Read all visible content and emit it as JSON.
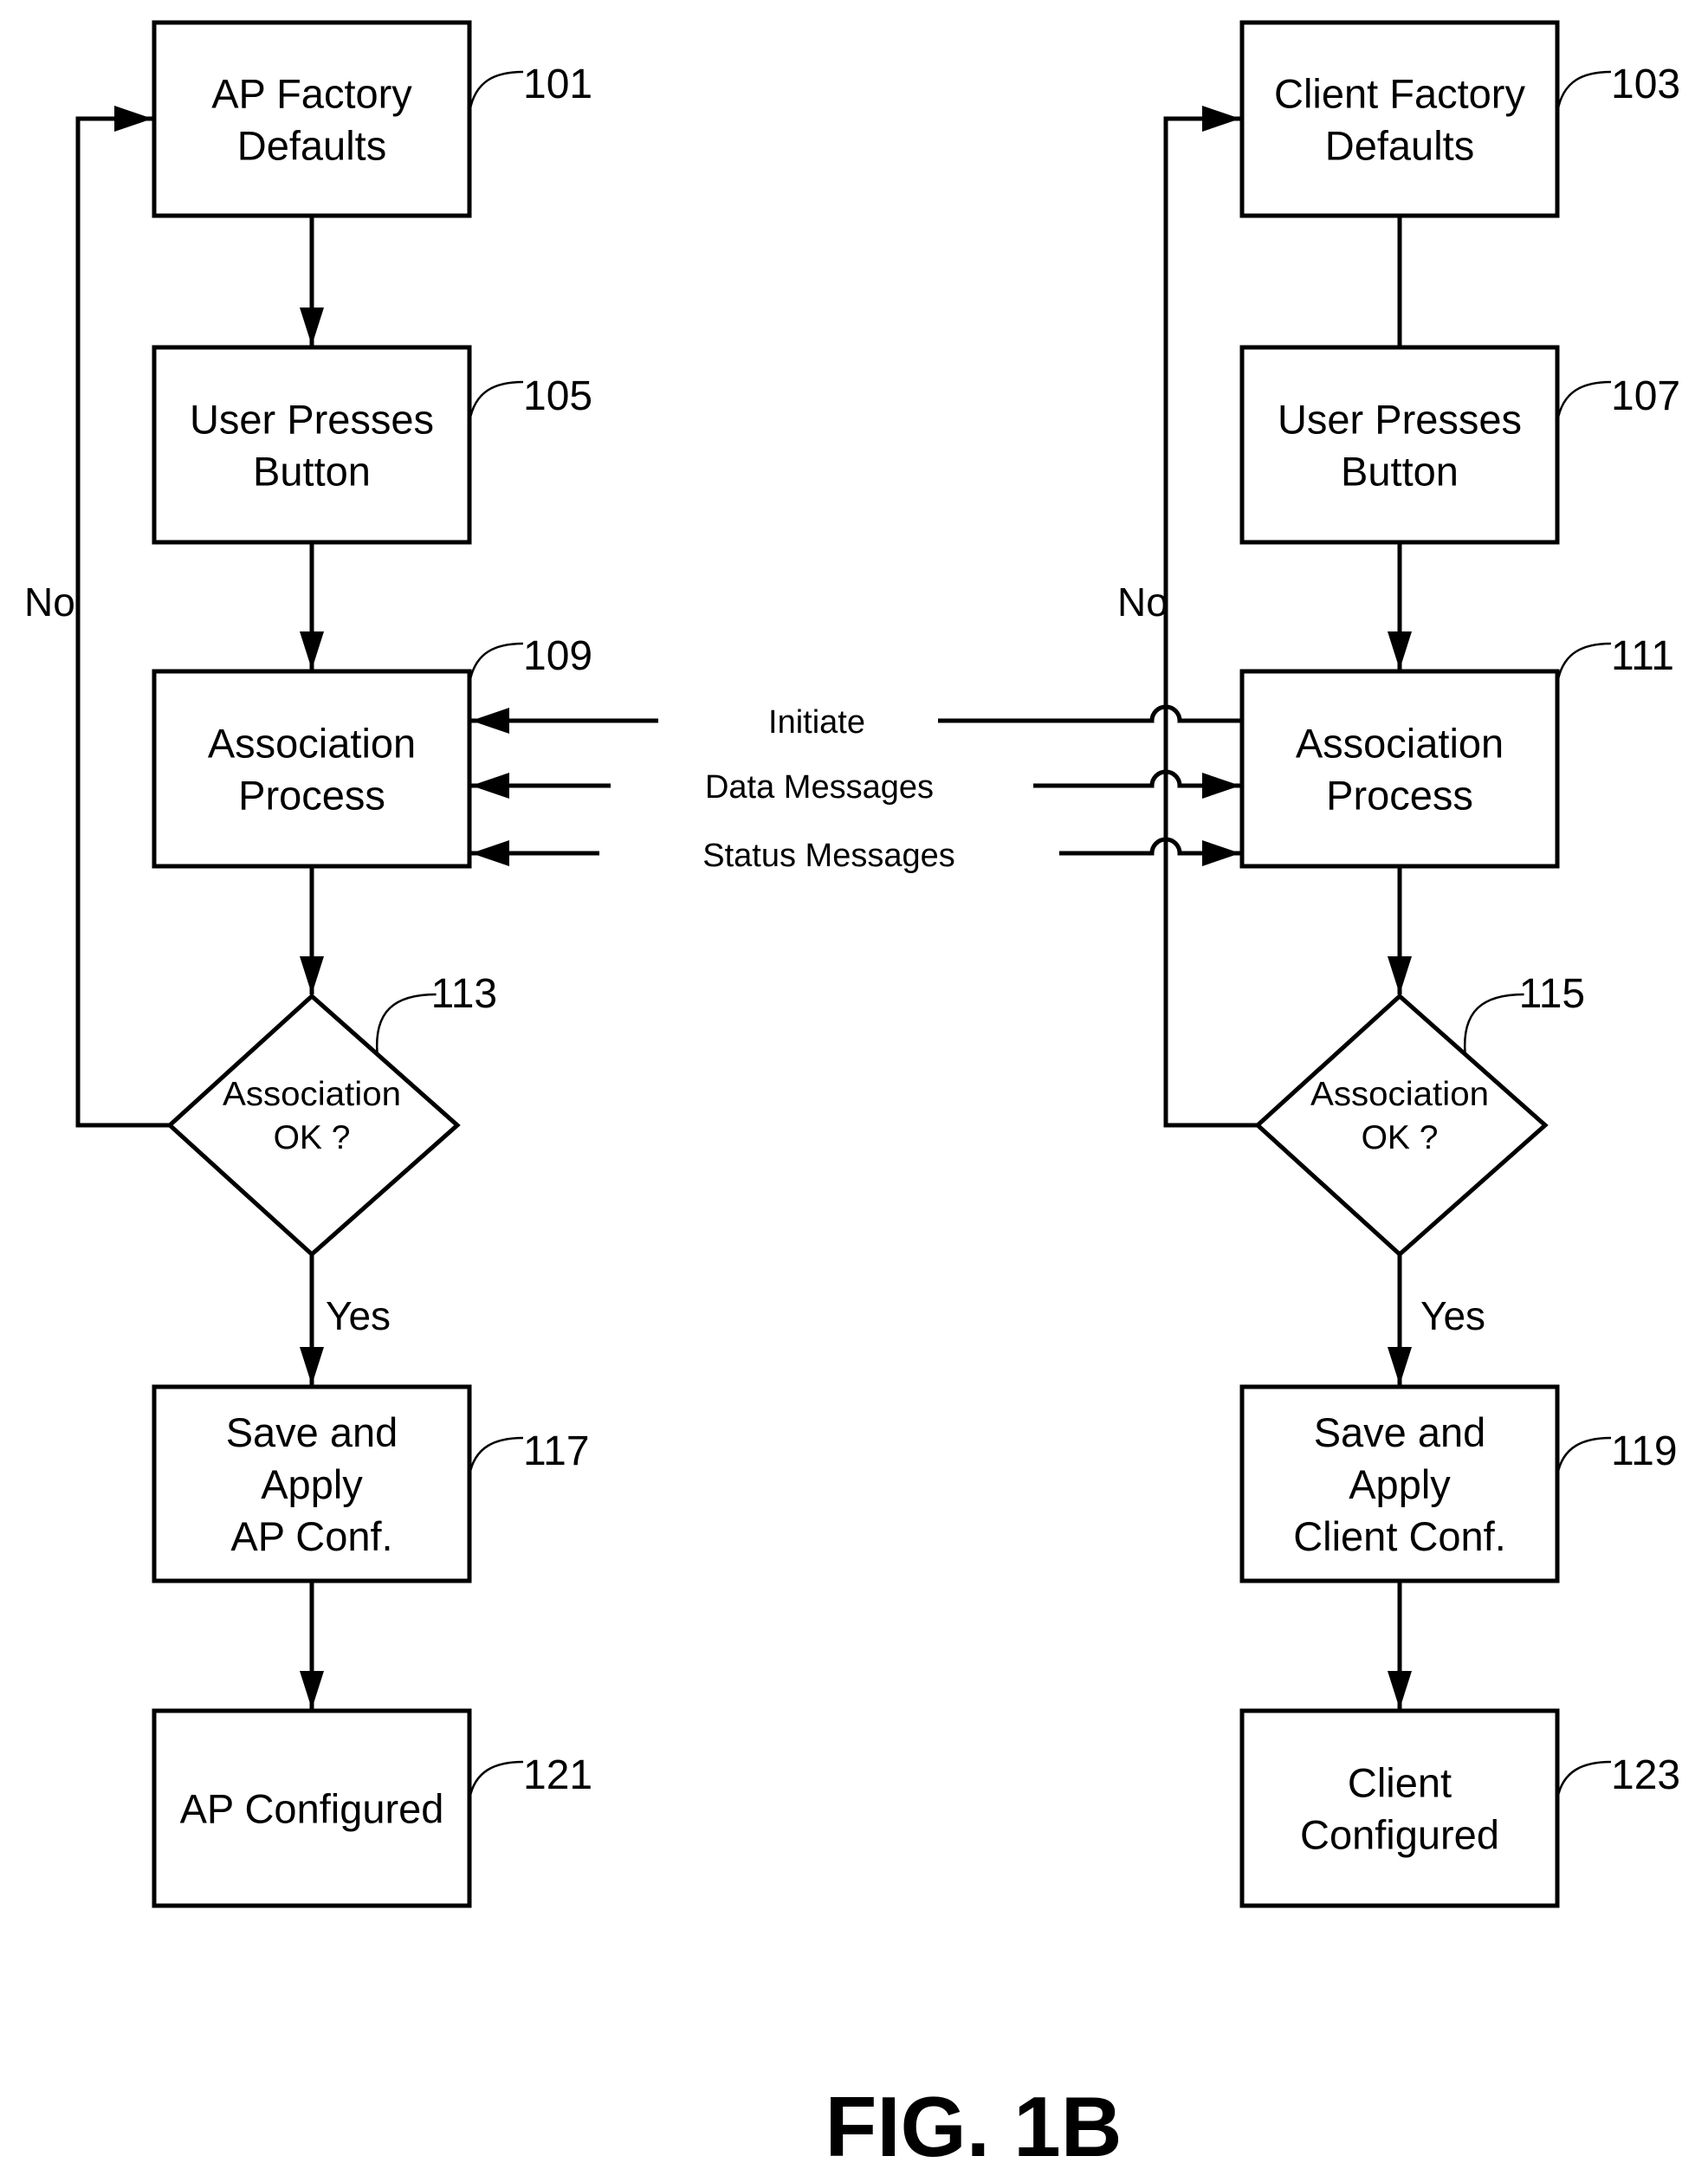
{
  "figure_label": "FIG. 1B",
  "branch_labels": {
    "no": "No",
    "yes": "Yes"
  },
  "messages": [
    {
      "id": "initiate",
      "label": "Initiate"
    },
    {
      "id": "data",
      "label": "Data Messages"
    },
    {
      "id": "status",
      "label": "Status Messages"
    }
  ],
  "columns": [
    {
      "id": "ap",
      "nodes": [
        {
          "ref": "101",
          "type": "box",
          "lines": [
            "AP Factory",
            "Defaults"
          ]
        },
        {
          "ref": "105",
          "type": "box",
          "lines": [
            "User Presses",
            "Button"
          ]
        },
        {
          "ref": "109",
          "type": "box",
          "lines": [
            "Association",
            "Process"
          ]
        },
        {
          "ref": "113",
          "type": "decision",
          "lines": [
            "Association",
            "OK ?"
          ]
        },
        {
          "ref": "117",
          "type": "box",
          "lines": [
            "Save and",
            "Apply",
            "AP Conf."
          ]
        },
        {
          "ref": "121",
          "type": "box",
          "lines": [
            "AP Configured"
          ]
        }
      ]
    },
    {
      "id": "client",
      "nodes": [
        {
          "ref": "103",
          "type": "box",
          "lines": [
            "Client Factory",
            "Defaults"
          ]
        },
        {
          "ref": "107",
          "type": "box",
          "lines": [
            "User Presses",
            "Button"
          ]
        },
        {
          "ref": "111",
          "type": "box",
          "lines": [
            "Association",
            "Process"
          ]
        },
        {
          "ref": "115",
          "type": "decision",
          "lines": [
            "Association",
            "OK ?"
          ]
        },
        {
          "ref": "119",
          "type": "box",
          "lines": [
            "Save and",
            "Apply",
            "Client Conf."
          ]
        },
        {
          "ref": "123",
          "type": "box",
          "lines": [
            "Client",
            "Configured"
          ]
        }
      ]
    }
  ],
  "connections": [
    {
      "from": "101",
      "to": "105",
      "arrow": true
    },
    {
      "from": "105",
      "to": "109",
      "arrow": true
    },
    {
      "from": "109",
      "to": "113",
      "arrow": true
    },
    {
      "from": "113",
      "to": "117",
      "arrow": true,
      "label": "yes"
    },
    {
      "from": "117",
      "to": "121",
      "arrow": true
    },
    {
      "from": "113",
      "to": "101",
      "arrow": true,
      "label": "no",
      "loop": true
    },
    {
      "from": "103",
      "to": "107",
      "arrow": false
    },
    {
      "from": "107",
      "to": "111",
      "arrow": true
    },
    {
      "from": "111",
      "to": "115",
      "arrow": true
    },
    {
      "from": "115",
      "to": "119",
      "arrow": true,
      "label": "yes"
    },
    {
      "from": "119",
      "to": "123",
      "arrow": true
    },
    {
      "from": "115",
      "to": "103",
      "arrow": true,
      "label": "no",
      "loop": true
    }
  ]
}
